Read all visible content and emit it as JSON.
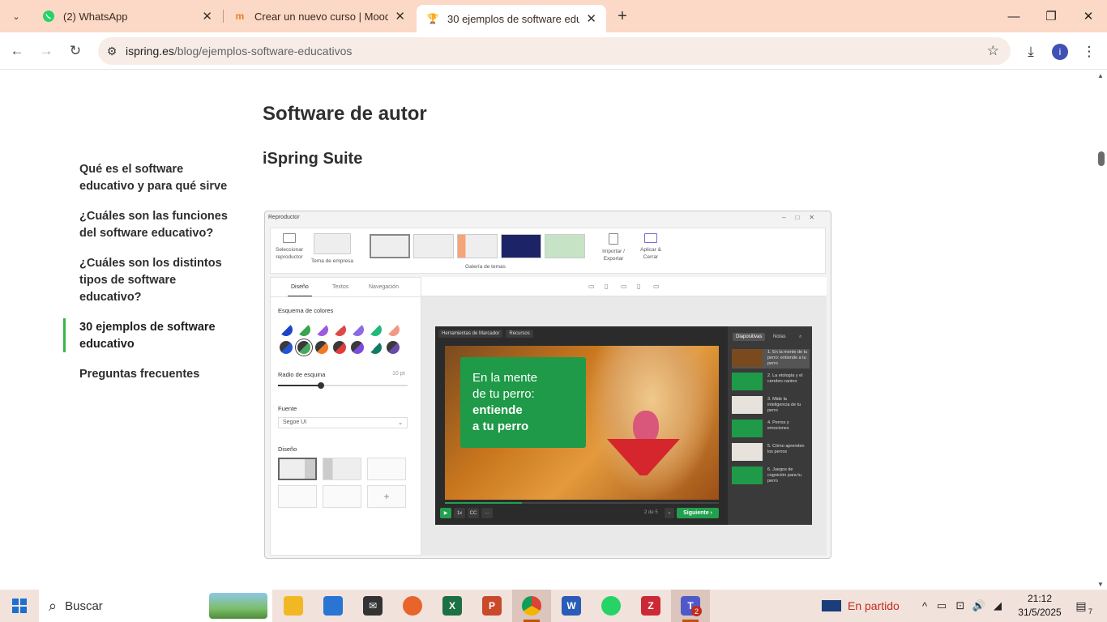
{
  "browser": {
    "tabs": [
      {
        "title": "(2) WhatsApp",
        "icon": "whatsapp-icon"
      },
      {
        "title": "Crear un nuevo curso | Moodle",
        "icon": "moodle-icon"
      },
      {
        "title": "30 ejemplos de software edu",
        "icon": "trophy-icon",
        "active": true
      }
    ],
    "url_domain": "ispring.es",
    "url_path": "/blog/ejemplos-software-educativos",
    "profile_initial": "i"
  },
  "page": {
    "toc": [
      "Qué es el software educativo y para qué sirve",
      "¿Cuáles son las funciones del software educativo?",
      "¿Cuáles son los distintos tipos de software educativo?",
      "30 ejemplos de software educativo",
      "Preguntas frecuentes"
    ],
    "toc_active": "30 ejemplos de software educativo",
    "section_title": "Software de autor",
    "subsection_title": "iSpring Suite",
    "screenshot": {
      "window_title": "Reproductor",
      "ribbon": {
        "select_player": "Seleccionar reproductor",
        "company_theme": "Tema de empresa",
        "gallery": "Galería de temas",
        "import_export": "Importar / Exportar",
        "apply_close": "Aplicar & Cerrar"
      },
      "tabs": [
        "Diseño",
        "Textos",
        "Navegación"
      ],
      "color_scheme_label": "Esquema de colores",
      "corner_radius_label": "Radio de esquina",
      "corner_radius_value": "10 pt",
      "corner_radius_fraction": 0.33,
      "font_label": "Fuente",
      "font_value": "Segoe UI",
      "layout_label": "Diseño",
      "player": {
        "toolbar": [
          "Herramientas de Marcador",
          "Recursos"
        ],
        "slide_line1": "En la mente",
        "slide_line2": "de tu perro:",
        "slide_line3": "entiende",
        "slide_line4": "a tu perro",
        "controls": [
          "1x",
          "CC",
          "···"
        ],
        "page": "2 de 5",
        "next": "Siguiente",
        "side_tabs": [
          "Diapositivas",
          "Notas"
        ],
        "slides": [
          "1. En la mente de tu perro: entiende a tu perro",
          "2. La etología y el cerebro canino",
          "3. Mide la inteligencia de tu perro",
          "4. Perros y emociones",
          "5. Cómo aprenden los perros",
          "6. Juegos de cognición para tu perro"
        ]
      }
    }
  },
  "taskbar": {
    "search_placeholder": "Buscar",
    "weather_text": "En partido",
    "time": "21:12",
    "date": "31/5/2025",
    "notifications": "7",
    "teams_badge": "2",
    "accent": "#c2530b"
  }
}
